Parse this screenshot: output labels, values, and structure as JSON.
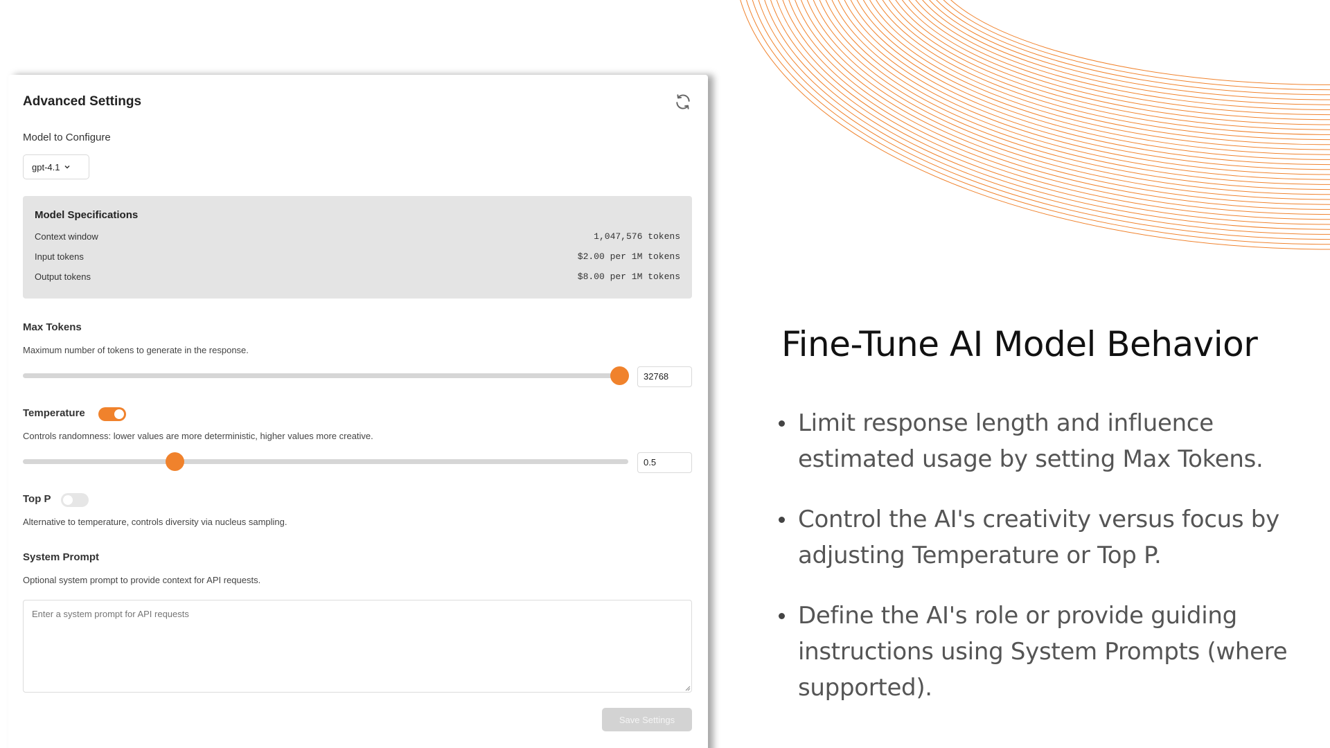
{
  "panel": {
    "title": "Advanced Settings",
    "refresh_icon": "refresh-icon",
    "model_label": "Model to Configure",
    "model_selected": "gpt-4.1",
    "specs": {
      "title": "Model Specifications",
      "rows": [
        {
          "label": "Context window",
          "value": "1,047,576 tokens"
        },
        {
          "label": "Input tokens",
          "value": "$2.00 per 1M tokens"
        },
        {
          "label": "Output tokens",
          "value": "$8.00 per 1M tokens"
        }
      ]
    },
    "max_tokens": {
      "label": "Max Tokens",
      "help": "Maximum number of tokens to generate in the response.",
      "value": "32768",
      "slider_fraction": 0.985
    },
    "temperature": {
      "label": "Temperature",
      "enabled": true,
      "help": "Controls randomness: lower values are more deterministic, higher values more creative.",
      "value": "0.5",
      "slider_fraction": 0.25
    },
    "top_p": {
      "label": "Top P",
      "enabled": false,
      "help": "Alternative to temperature, controls diversity via nucleus sampling."
    },
    "system_prompt": {
      "label": "System Prompt",
      "help": "Optional system prompt to provide context for API requests.",
      "placeholder": "Enter a system prompt for API requests"
    },
    "save_label": "Save Settings"
  },
  "slide": {
    "headline": "Fine-Tune AI Model Behavior",
    "bullets": [
      "Limit response length and influence estimated usage by setting Max Tokens.",
      "Control the AI's creativity versus focus by adjusting Temperature or Top P.",
      "Define the AI's role or provide guiding instructions using System Prompts (where supported)."
    ]
  },
  "colors": {
    "accent": "#f0822c",
    "arc": "#f0822c"
  }
}
